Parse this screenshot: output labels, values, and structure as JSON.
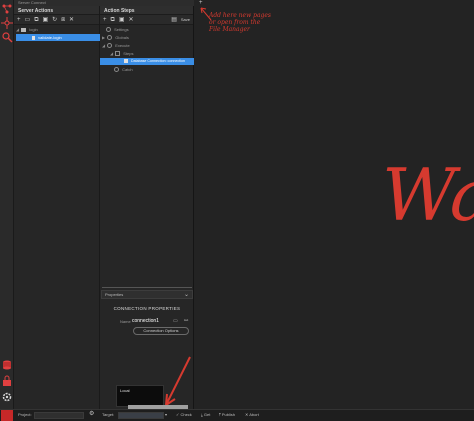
{
  "window": {
    "title": "Server Connect"
  },
  "panels": {
    "server_actions": {
      "title": "Server Actions"
    },
    "action_steps": {
      "title": "Action Steps",
      "save_label": "Save"
    }
  },
  "server_actions_tree": {
    "root": "login",
    "file": "validate-login"
  },
  "action_steps_tree": {
    "settings": "Settings",
    "globals": "Globals",
    "execute": "Execute",
    "steps": "Steps",
    "db_connection": "Database Connection: connection",
    "catch": "Catch"
  },
  "properties": {
    "header": "Properties",
    "section_title": "CONNECTION PROPERTIES",
    "name_label": "Name",
    "name_value": "connection1",
    "options_button": "Connection Options"
  },
  "annotation": {
    "top_text": "Add here new pages\nor open from the\nFile Manager",
    "canvas_text": "Wa"
  },
  "target_popup": {
    "item": "Local"
  },
  "bottom_bar": {
    "project_label": "Project:",
    "target_label": "Target:",
    "check_label": "Check",
    "get_label": "Get",
    "publish_label": "Publish",
    "abort_label": "Abort"
  },
  "colors": {
    "accent": "#3a8ee6",
    "annotation_red": "#d63a2f",
    "background": "#212121"
  }
}
